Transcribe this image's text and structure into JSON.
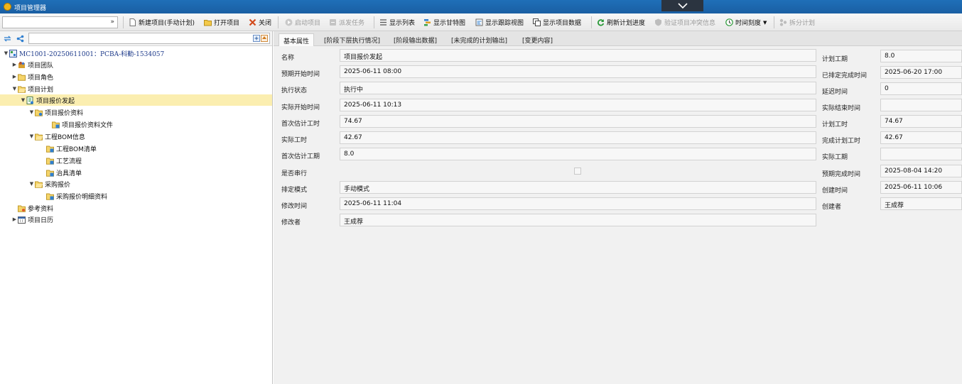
{
  "window": {
    "title": "项目管理器"
  },
  "toolbar": {
    "new_project": "新建项目(手动计划)",
    "open_project": "打开项目",
    "close": "关闭",
    "start_project": "启动项目",
    "dispatch_task": "派发任务",
    "show_list": "显示列表",
    "show_gantt": "显示甘特图",
    "show_tracking": "显示跟踪视图",
    "show_data": "显示项目数据",
    "refresh_progress": "刷新计划进度",
    "verify_conflict": "验证项目冲突信息",
    "time_scale": "时间刻度",
    "split_plan": "拆分计划"
  },
  "tree": [
    {
      "label": "MC1001-20250611001：PCBA-科勤-1534057",
      "twisty": "▼",
      "icon": "project-icon"
    },
    {
      "label": "项目团队",
      "twisty": "▶",
      "icon": "team-icon"
    },
    {
      "label": "项目角色",
      "twisty": "▶",
      "icon": "folder-icon"
    },
    {
      "label": "项目计划",
      "twisty": "▼",
      "icon": "folder-open-icon"
    },
    {
      "label": "项目报价发起",
      "twisty": "▼",
      "icon": "task-icon",
      "selected": true
    },
    {
      "label": "项目报价资料",
      "twisty": "▼",
      "icon": "folder-open-icon"
    },
    {
      "label": "项目报价资料文件",
      "twisty": "",
      "icon": "document-folder-icon"
    },
    {
      "label": "工程BOM信息",
      "twisty": "▼",
      "icon": "folder-open-icon"
    },
    {
      "label": "工程BOM清单",
      "twisty": "",
      "icon": "document-folder-icon"
    },
    {
      "label": "工艺流程",
      "twisty": "",
      "icon": "document-folder-icon"
    },
    {
      "label": "治具清单",
      "twisty": "",
      "icon": "document-folder-icon"
    },
    {
      "label": "采购报价",
      "twisty": "▼",
      "icon": "folder-open-icon"
    },
    {
      "label": "采购报价明细资料",
      "twisty": "",
      "icon": "document-folder-icon"
    },
    {
      "label": "参考资料",
      "twisty": "",
      "icon": "folder-icon"
    },
    {
      "label": "项目日历",
      "twisty": "▶",
      "icon": "calendar-icon"
    }
  ],
  "tabs": [
    "基本属性",
    "[阶段下层执行情况]",
    "[阶段输出数据]",
    "[未完成的计划输出]",
    "[变更内容]"
  ],
  "fields_left": [
    {
      "label": "名称",
      "value": "项目报价发起"
    },
    {
      "label": "预期开始时间",
      "value": "2025-06-11 08:00"
    },
    {
      "label": "执行状态",
      "value": "执行中"
    },
    {
      "label": "实际开始时间",
      "value": "2025-06-11 10:13"
    },
    {
      "label": "首次估计工时",
      "value": "74.67"
    },
    {
      "label": "实际工时",
      "value": "42.67"
    },
    {
      "label": "首次估计工期",
      "value": "8.0"
    },
    {
      "label": "是否串行",
      "value": ""
    },
    {
      "label": "排定模式",
      "value": "手动模式"
    },
    {
      "label": "修改时间",
      "value": "2025-06-11 11:04"
    },
    {
      "label": "修改者",
      "value": "王成荐"
    }
  ],
  "fields_right": [
    {
      "label": "计划工期",
      "value": "8.0"
    },
    {
      "label": "已排定完成时间",
      "value": "2025-06-20 17:00"
    },
    {
      "label": "延迟时间",
      "value": "0"
    },
    {
      "label": "实际结束时间",
      "value": ""
    },
    {
      "label": "计划工时",
      "value": "74.67"
    },
    {
      "label": "完成计划工时",
      "value": "42.67"
    },
    {
      "label": "实际工期",
      "value": ""
    },
    {
      "label": "预期完成时间",
      "value": "2025-08-04 14:20"
    },
    {
      "label": "创建时间",
      "value": "2025-06-11 10:06"
    },
    {
      "label": "创建者",
      "value": "王成荐"
    }
  ],
  "colors": {
    "titlebar": "#1f6fb8",
    "selection": "#fbeeb0",
    "tree_root_text": "#1d3a8a"
  }
}
